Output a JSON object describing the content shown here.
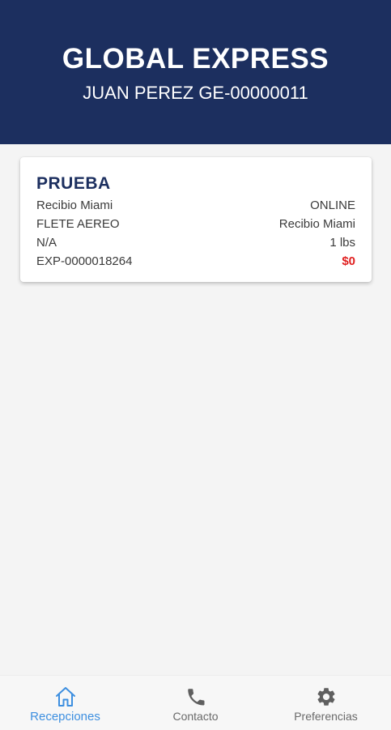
{
  "header": {
    "brand": "GLOBAL EXPRESS",
    "user_line": "JUAN PEREZ GE-00000011"
  },
  "receptions": [
    {
      "title": "PRUEBA",
      "rows": [
        {
          "left": "Recibio Miami",
          "right": "ONLINE"
        },
        {
          "left": "FLETE AEREO",
          "right": "Recibio Miami"
        },
        {
          "left": "N/A",
          "right": "1 lbs"
        },
        {
          "left": "EXP-0000018264",
          "right": "$0"
        }
      ]
    }
  ],
  "bottom_nav": {
    "items": [
      {
        "label": "Recepciones",
        "icon": "home-icon",
        "active": true
      },
      {
        "label": "Contacto",
        "icon": "phone-icon",
        "active": false
      },
      {
        "label": "Preferencias",
        "icon": "gear-icon",
        "active": false
      }
    ]
  },
  "colors": {
    "header_bg": "#1c2f5f",
    "accent": "#3d8fe0",
    "amount": "#e02020"
  }
}
